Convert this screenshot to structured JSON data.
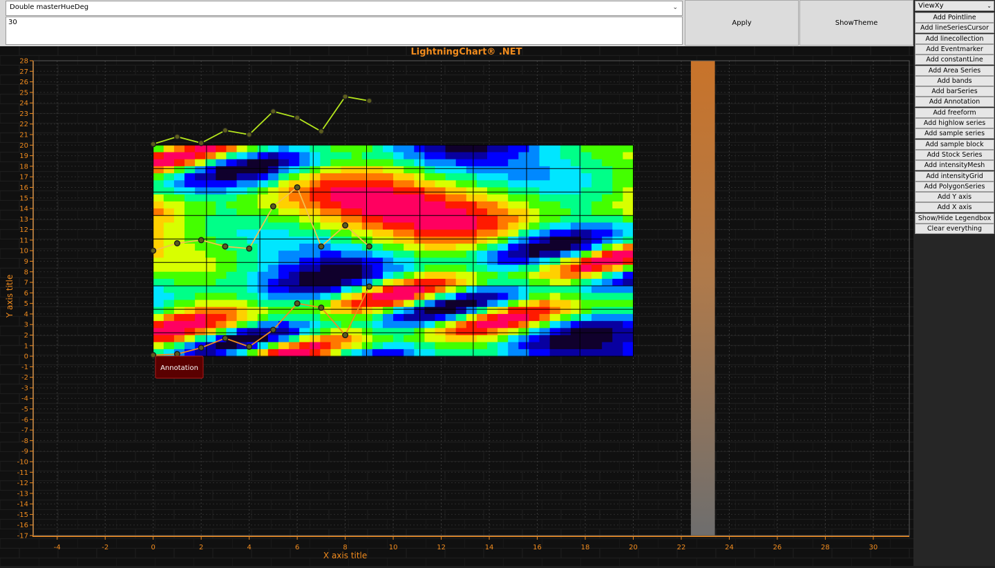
{
  "toolbar": {
    "property_select": "Double masterHueDeg",
    "value_input": "30",
    "apply_label": "Apply",
    "theme_label": "ShowTheme"
  },
  "panel": {
    "view_select": "ViewXy",
    "buttons": [
      "Add Pointline",
      "Add lineSeriesCursor",
      "Add linecollection",
      "Add Eventmarker",
      "Add constantLine",
      "Add Area Series",
      "Add bands",
      "Add barSeries",
      "Add Annotation",
      "Add freeform",
      "Add highlow series",
      "Add sample series",
      "Add sample block",
      "Add Stock Series",
      "Add intensityMesh",
      "Add intensityGrid",
      "Add PolygonSeries",
      "Add Y axis",
      "Add X axis",
      "Show/Hide Legendbox",
      "Clear everything"
    ]
  },
  "colors": {
    "accent": "#f28c1e",
    "band": "#c87a2a",
    "annotation_bg": "#5a0000"
  },
  "chart_data": {
    "type": "line",
    "title": "LightningChart® .NET",
    "xlabel": "X axis title",
    "ylabel": "Y axis title",
    "xlim": [
      -5,
      31.5
    ],
    "ylim": [
      -17,
      28
    ],
    "xticks": [
      -4,
      -2,
      0,
      2,
      4,
      6,
      8,
      10,
      12,
      14,
      16,
      18,
      20,
      22,
      24,
      26,
      28,
      30
    ],
    "yticks": [
      -17,
      -16,
      -15,
      -14,
      -13,
      -12,
      -11,
      -10,
      -9,
      -8,
      -7,
      -6,
      -5,
      -4,
      -3,
      -2,
      -1,
      0,
      1,
      2,
      3,
      4,
      5,
      6,
      7,
      8,
      9,
      10,
      11,
      12,
      13,
      14,
      15,
      16,
      17,
      18,
      19,
      20,
      21,
      22,
      23,
      24,
      25,
      26,
      27,
      28
    ],
    "series": [
      {
        "x": [
          0,
          1,
          2,
          3,
          4,
          5,
          6,
          7,
          8,
          9
        ],
        "values": [
          20.1,
          20.8,
          20.2,
          21.4,
          21.0,
          23.2,
          22.6,
          21.3,
          24.6,
          24.2
        ],
        "color": "#b5e61d"
      },
      {
        "x": [
          0,
          1,
          2,
          3,
          4,
          5,
          6,
          7,
          8,
          9
        ],
        "values": [
          10.0,
          10.7,
          11.0,
          10.4,
          10.2,
          14.2,
          16.0,
          10.4,
          12.4,
          10.4
        ],
        "color": "#f2c14e"
      },
      {
        "x": [
          0,
          1,
          2,
          3,
          4,
          5,
          6,
          7,
          8,
          9
        ],
        "values": [
          0.1,
          0.2,
          0.8,
          1.7,
          0.9,
          2.5,
          5.0,
          4.6,
          2.0,
          6.6
        ],
        "color": "#f28c1e"
      }
    ],
    "intensity_grid": {
      "x_range": [
        0,
        20
      ],
      "y_range": [
        0,
        20
      ],
      "cols": 9,
      "rows": 9
    },
    "band": {
      "x_range": [
        22.4,
        23.4
      ]
    },
    "annotation": {
      "text": "Annotation",
      "target": [
        6,
        0
      ]
    },
    "grid": true
  }
}
